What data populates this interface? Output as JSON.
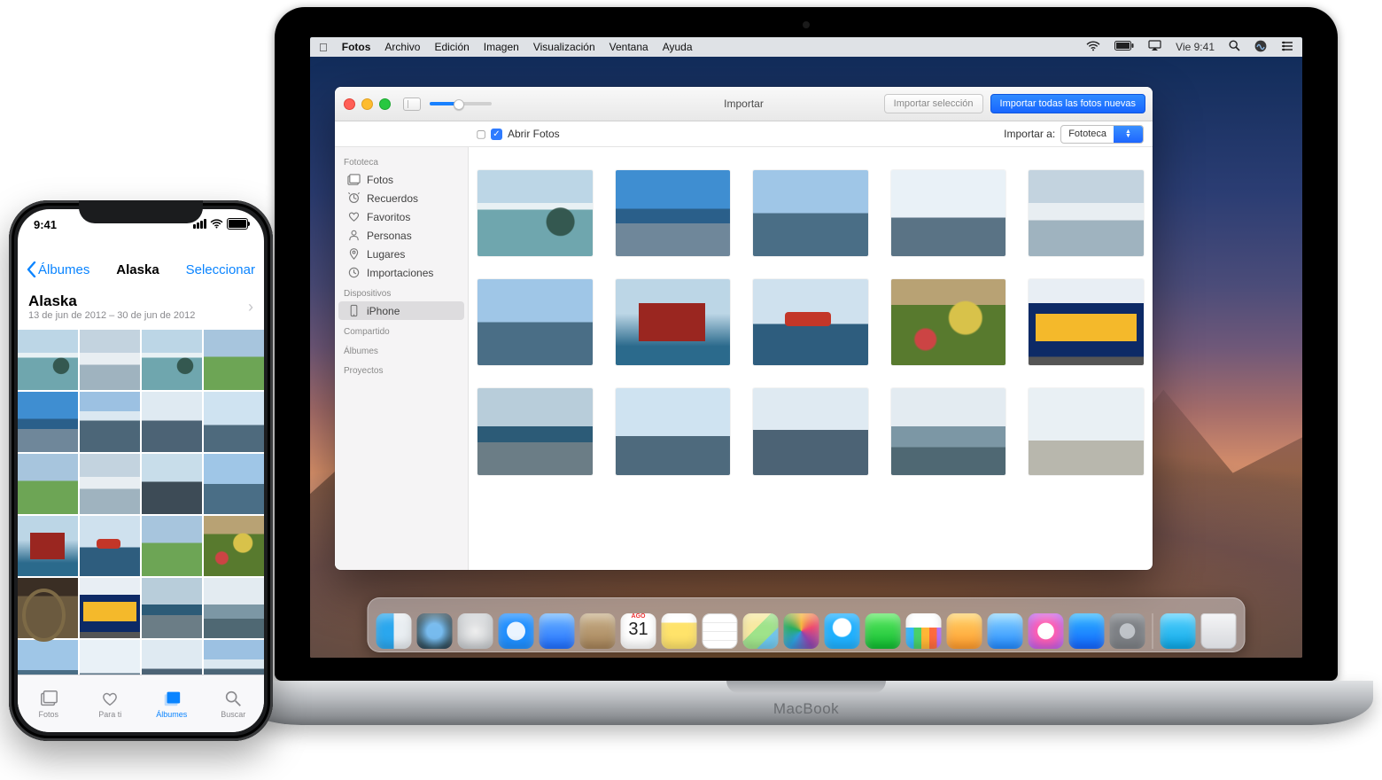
{
  "menubar": {
    "app": "Fotos",
    "items": [
      "Archivo",
      "Edición",
      "Imagen",
      "Visualización",
      "Ventana",
      "Ayuda"
    ],
    "clock": "Vie 9:41"
  },
  "window": {
    "title": "Importar",
    "btn_import_selection": "Importar selección",
    "btn_import_all": "Importar todas las fotos nuevas",
    "checkbox_label": "Abrir Fotos",
    "import_to_label": "Importar a:",
    "import_to_value": "Fototeca"
  },
  "sidebar": {
    "section_library": "Fototeca",
    "items_library": [
      {
        "key": "fotos",
        "label": "Fotos"
      },
      {
        "key": "recuerdos",
        "label": "Recuerdos"
      },
      {
        "key": "favoritos",
        "label": "Favoritos"
      },
      {
        "key": "personas",
        "label": "Personas"
      },
      {
        "key": "lugares",
        "label": "Lugares"
      },
      {
        "key": "importaciones",
        "label": "Importaciones"
      }
    ],
    "section_devices": "Dispositivos",
    "device_label": "iPhone",
    "section_shared": "Compartido",
    "section_albums": "Álbumes",
    "section_projects": "Proyectos"
  },
  "dock": {
    "cal_month": "AGO",
    "cal_day": "31"
  },
  "mac_brand": "MacBook",
  "iphone": {
    "time": "9:41",
    "back": "Álbumes",
    "title": "Alaska",
    "action": "Seleccionar",
    "album_name": "Alaska",
    "album_dates": "13 de jun de 2012 – 30 de jun de 2012",
    "tabs": {
      "fotos": "Fotos",
      "parati": "Para ti",
      "albumes": "Álbumes",
      "buscar": "Buscar"
    }
  }
}
